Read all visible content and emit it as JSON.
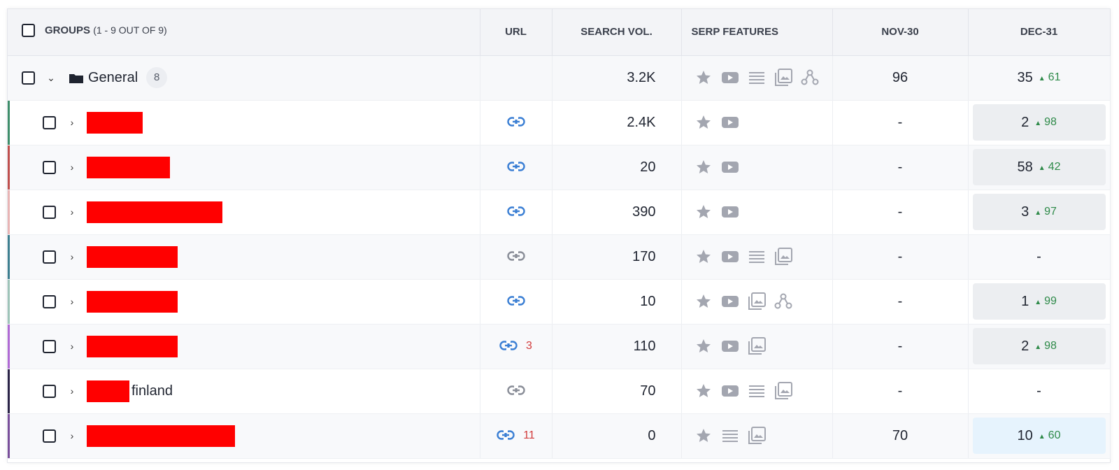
{
  "header": {
    "groups_label": "GROUPS",
    "groups_count": "(1 - 9 OUT OF 9)",
    "url": "URL",
    "search_vol": "SEARCH VOL.",
    "serp_features": "SERP FEATURES",
    "nov": "NOV-30",
    "dec": "DEC-31"
  },
  "group": {
    "title": "General",
    "count": "8",
    "vol": "3.2K",
    "serp": [
      "star-icon",
      "video-icon",
      "list-icon",
      "image-pack-icon",
      "knowledge-graph-icon"
    ],
    "nov": "96",
    "dec": "35",
    "dec_delta": "61"
  },
  "rows": [
    {
      "bar": "#3e8e6a",
      "redact_w": 80,
      "suffix": "",
      "url_color": "#3b7fd4",
      "url_count": "",
      "vol": "2.4K",
      "serp": [
        "star-icon",
        "video-icon"
      ],
      "nov": "-",
      "dec": "2",
      "dec_delta": "98",
      "hl": "gray"
    },
    {
      "bar": "#c0504d",
      "redact_w": 119,
      "suffix": "",
      "url_color": "#3b7fd4",
      "url_count": "",
      "vol": "20",
      "serp": [
        "star-icon",
        "video-icon"
      ],
      "nov": "-",
      "dec": "58",
      "dec_delta": "42",
      "hl": "gray"
    },
    {
      "bar": "#e8b4b4",
      "redact_w": 194,
      "suffix": "",
      "url_color": "#3b7fd4",
      "url_count": "",
      "vol": "390",
      "serp": [
        "star-icon",
        "video-icon"
      ],
      "nov": "-",
      "dec": "3",
      "dec_delta": "97",
      "hl": "gray"
    },
    {
      "bar": "#3d7f8f",
      "redact_w": 130,
      "suffix": "",
      "url_color": "#8a8e98",
      "url_count": "",
      "vol": "170",
      "serp": [
        "star-icon",
        "video-icon",
        "list-icon",
        "image-pack-icon"
      ],
      "nov": "-",
      "dec": "-",
      "dec_delta": "",
      "hl": ""
    },
    {
      "bar": "#9ec4b8",
      "redact_w": 130,
      "suffix": "",
      "url_color": "#3b7fd4",
      "url_count": "",
      "vol": "10",
      "serp": [
        "star-icon",
        "video-icon",
        "image-pack-icon",
        "knowledge-graph-icon"
      ],
      "nov": "-",
      "dec": "1",
      "dec_delta": "99",
      "hl": "gray"
    },
    {
      "bar": "#b06ad4",
      "redact_w": 130,
      "suffix": "",
      "url_color": "#3b7fd4",
      "url_count": "3",
      "vol": "110",
      "serp": [
        "star-icon",
        "video-icon",
        "image-pack-icon"
      ],
      "nov": "-",
      "dec": "2",
      "dec_delta": "98",
      "hl": "gray"
    },
    {
      "bar": "#2a2346",
      "redact_w": 61,
      "suffix": "finland",
      "url_color": "#8a8e98",
      "url_count": "",
      "vol": "70",
      "serp": [
        "star-icon",
        "video-icon",
        "list-icon",
        "image-pack-icon"
      ],
      "nov": "-",
      "dec": "-",
      "dec_delta": "",
      "hl": ""
    },
    {
      "bar": "#7a4f9a",
      "redact_w": 212,
      "suffix": "",
      "url_color": "#3b7fd4",
      "url_count": "11",
      "vol": "0",
      "serp": [
        "star-icon",
        "list-icon",
        "image-pack-icon"
      ],
      "nov": "70",
      "dec": "10",
      "dec_delta": "60",
      "hl": "blue"
    }
  ]
}
